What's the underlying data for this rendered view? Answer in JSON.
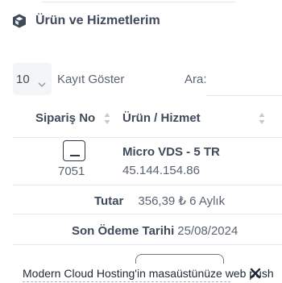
{
  "panel": {
    "icon": "server-box-icon",
    "title": "Ürün ve Hizmetlerim"
  },
  "controls": {
    "length_value": "10",
    "length_label": "Kayıt Göster",
    "search_label": "Ara:",
    "search_value": ""
  },
  "table": {
    "columns": [
      "Sipariş No",
      "Ürün / Hizmet"
    ],
    "rows": [
      {
        "order_id": "7051",
        "service_name": "Micro VDS - 5 TR",
        "service_ip": "45.144.154.86"
      }
    ]
  },
  "details": {
    "price_label": "Tutar",
    "price_value": "356,39 ₺ 6 Aylık",
    "due_label": "Son Ödeme Tarihi",
    "due_value": "25/08/2024"
  },
  "push_banner": {
    "text": "Modern Cloud Hosting'in masaüstünüze web push"
  },
  "colors": {
    "text_dark": "#3f4a5a",
    "text": "#5a6473",
    "border": "#e6e9ee",
    "select_bg": "#f3f5f7"
  }
}
